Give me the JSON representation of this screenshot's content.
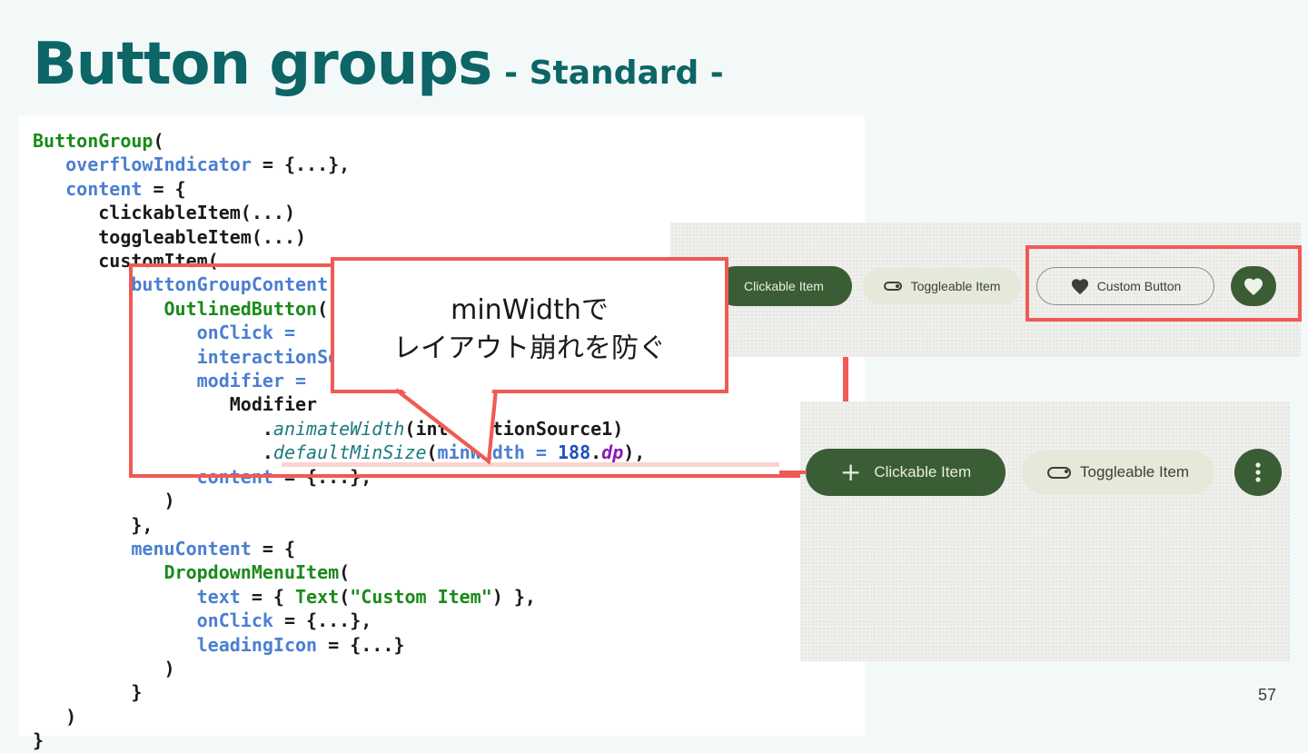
{
  "slide": {
    "title": "Button groups",
    "subtitle": "- Standard -",
    "page_number": "57"
  },
  "callout": {
    "line1": "minWidthで",
    "line2": "レイアウト崩れを防ぐ"
  },
  "code": {
    "l1": "ButtonGroup",
    "l2a": "overflowIndicator",
    "l2b": " = {...},",
    "l3a": "content",
    "l3b": " = {",
    "l4": "clickableItem(...)",
    "l5": "toggleableItem(...)",
    "l6": "customItem(",
    "l7": "buttonGroupContent = {",
    "l8": "OutlinedButton",
    "l9": "onClick = ",
    "l10": "interactionSource = interactionSource1,",
    "l11": "modifier = ",
    "l12": "Modifier",
    "l13a": "animateWidth",
    "l13b": "interactionSource1)",
    "l14a": "defaultMinSize",
    "l14b": "minWidth = ",
    "l14c": "188",
    "l14d": "dp",
    "l15a": "content",
    "l15b": " = {...},",
    "l16": ")",
    "l17": "},",
    "l18a": "menuContent",
    "l18b": " = {",
    "l19": "DropdownMenuItem",
    "l20a": "text",
    "l20b": " = { ",
    "l20c": "Text",
    "l20d": "\"Custom Item\"",
    "l20e": ") },",
    "l21a": "onClick",
    "l21b": " = {...},",
    "l22a": "leadingIcon",
    "l22b": " = {...}",
    "l23": ")",
    "l24": "}",
    "l25": ")",
    "l26": "}"
  },
  "screenshot_top": {
    "clickable_label": "Clickable Item",
    "toggleable_label": "Toggleable Item",
    "custom_label": "Custom Button"
  },
  "screenshot_bottom": {
    "clickable_label": "Clickable Item",
    "toggleable_label": "Toggleable Item"
  },
  "colors": {
    "accent_teal": "#0d6566",
    "highlight_red": "#f05a55",
    "button_dark_green": "#3b5d35",
    "button_light": "#e4e9da"
  }
}
